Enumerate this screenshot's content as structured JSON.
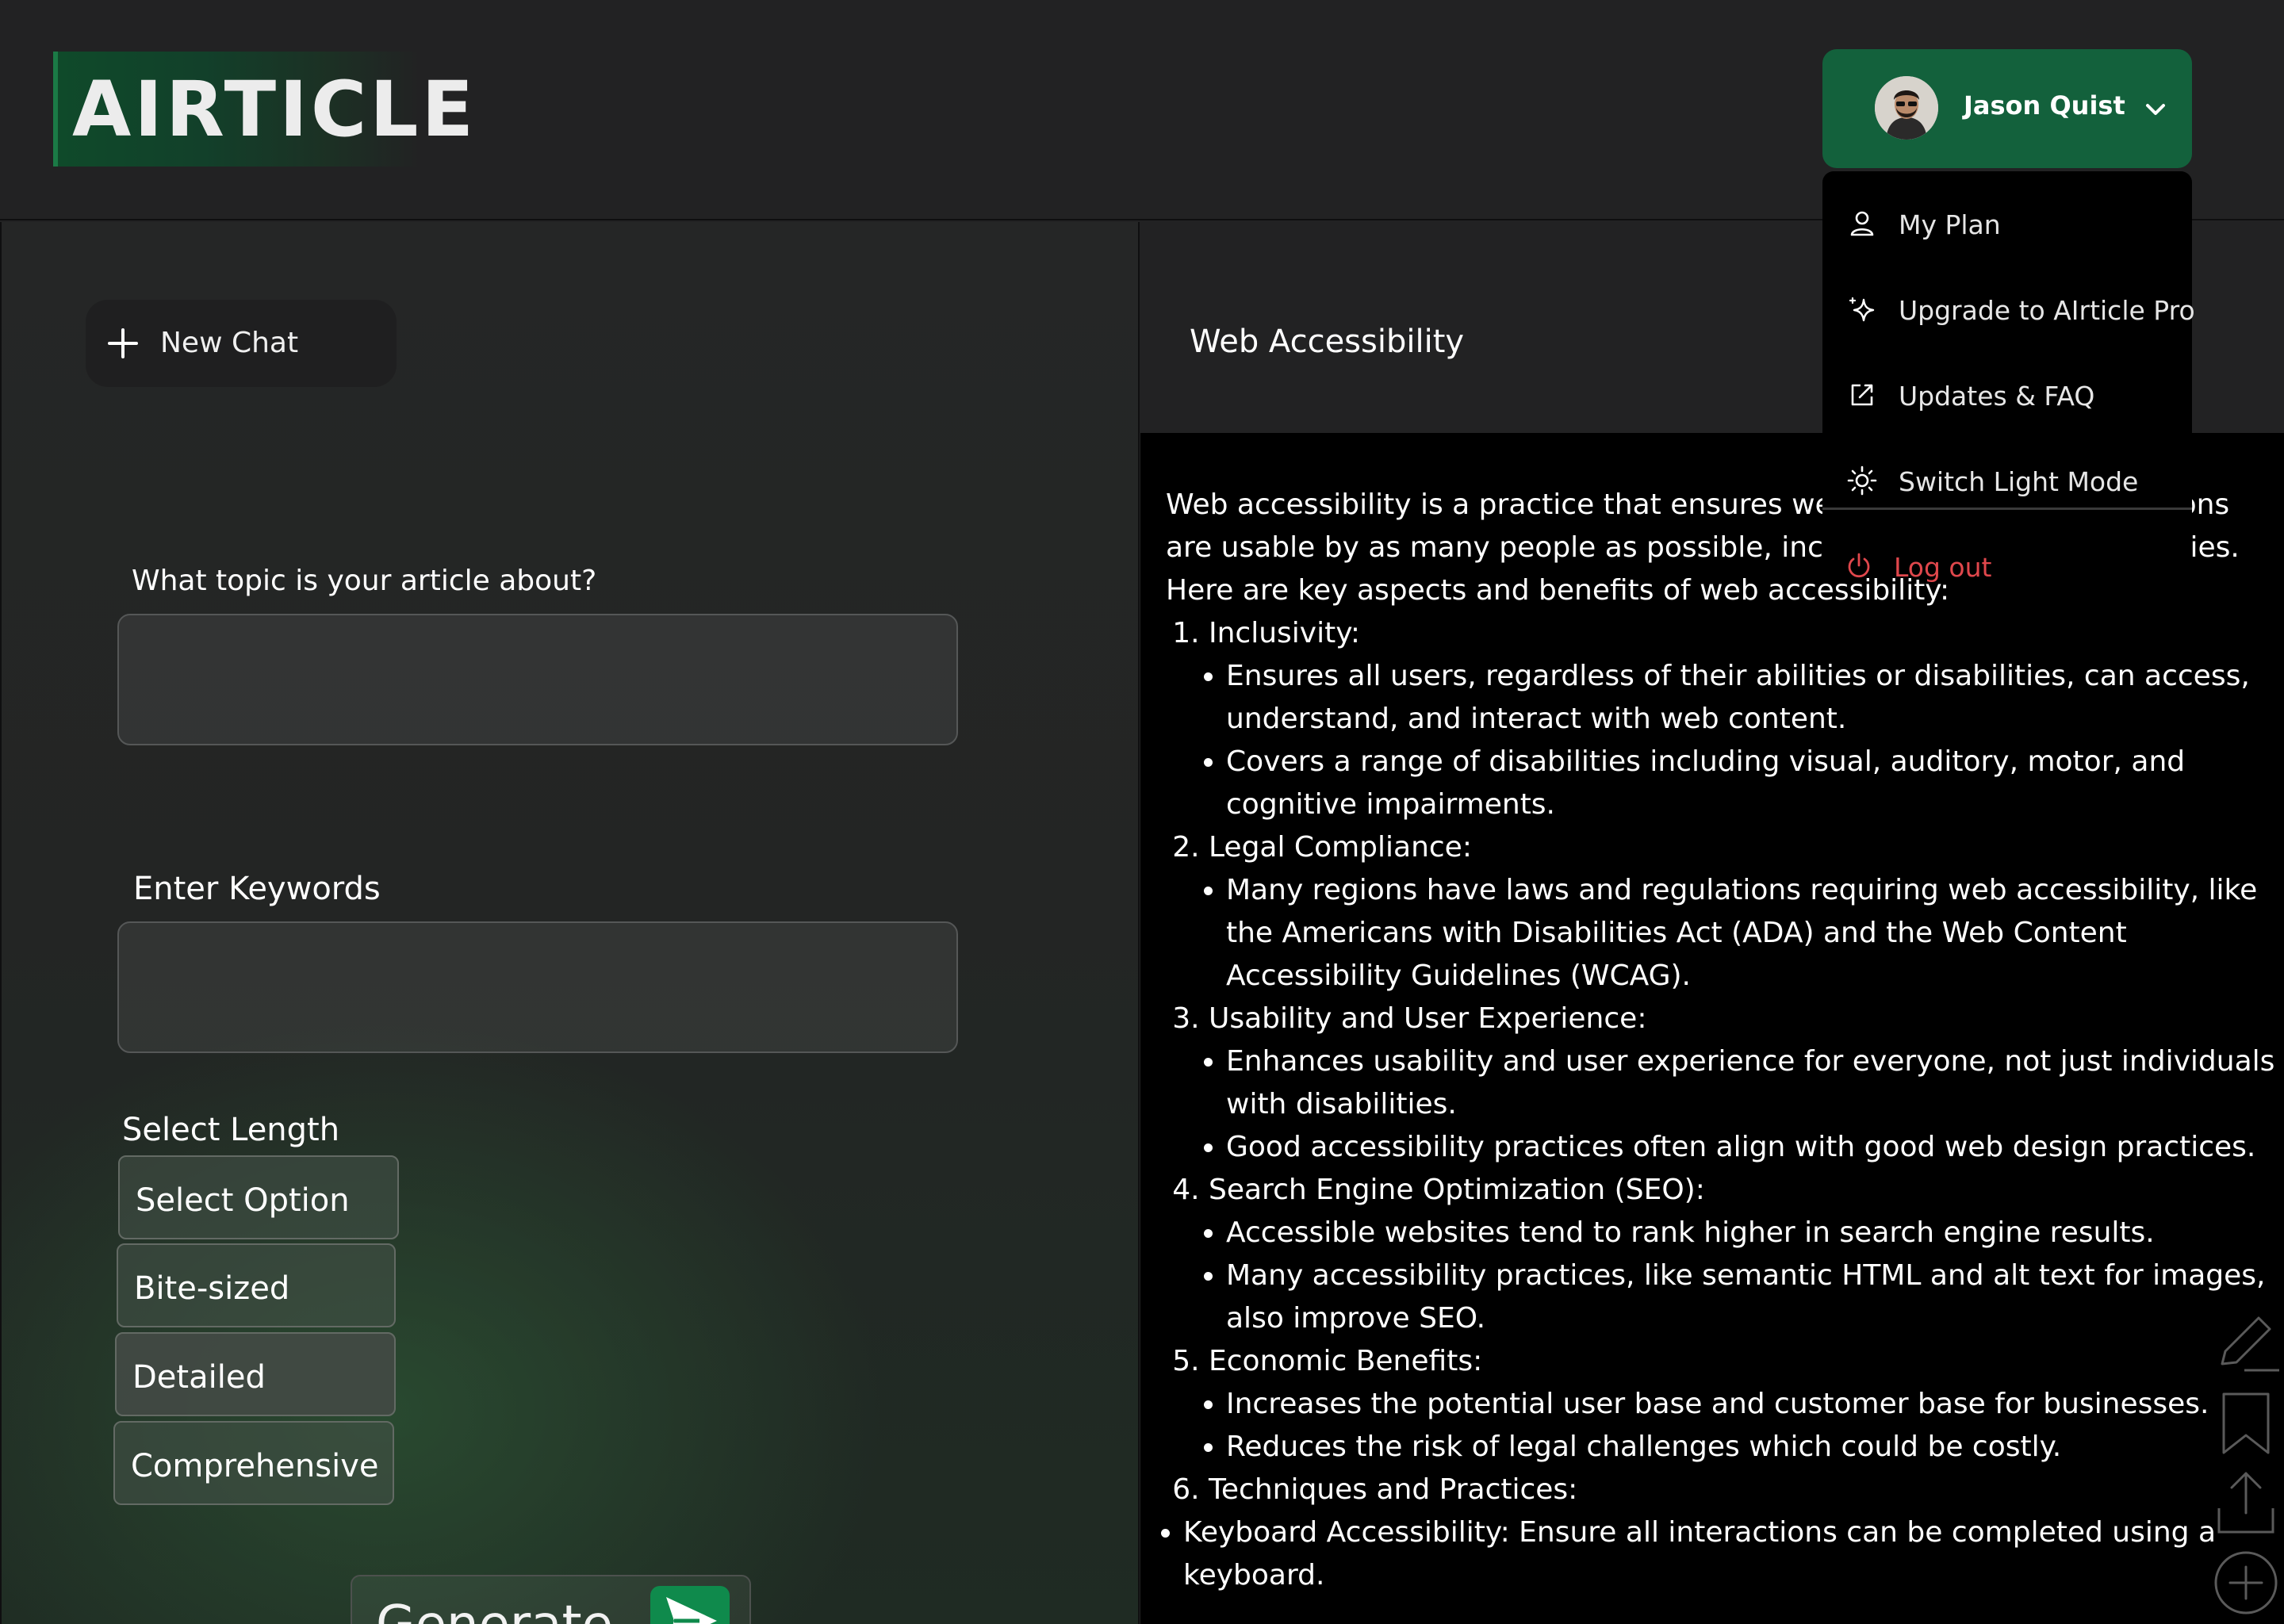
{
  "app": {
    "logo": "AIRTICLE",
    "accent_color": "#13613c"
  },
  "user": {
    "name": "Jason Quist",
    "menu": {
      "items": [
        {
          "icon": "user-icon",
          "label": "My Plan"
        },
        {
          "icon": "sparkle-icon",
          "label": "Upgrade to AIrticle Pro"
        },
        {
          "icon": "external-link-icon",
          "label": "Updates & FAQ"
        },
        {
          "icon": "sun-icon",
          "label": "Switch Light Mode"
        }
      ],
      "logout": {
        "icon": "power-icon",
        "label": "Log out",
        "color": "#e0474c"
      }
    }
  },
  "sidebar": {
    "new_chat": "New Chat"
  },
  "form": {
    "topic_label": "What topic is your article about?",
    "topic_value": "",
    "keywords_label": "Enter Keywords",
    "keywords_value": "",
    "length_label": "Select Length",
    "length_options": [
      "Select Option",
      "Bite-sized",
      "Detailed",
      "Comprehensive"
    ],
    "generate_label": "Generate"
  },
  "article": {
    "title": "Web Accessibility",
    "intro": "Web accessibility is a practice that ensures websites and web applications are usable by as many people as possible, including those with disabilities. Here are key aspects and benefits of web accessibility:",
    "sections": [
      {
        "heading": "Inclusivity:",
        "points": [
          "Ensures all users, regardless of their abilities or disabilities, can access, understand, and interact with web content.",
          "Covers a range of disabilities including visual, auditory, motor, and cognitive impairments."
        ]
      },
      {
        "heading": "Legal Compliance:",
        "points": [
          "Many regions have laws and regulations requiring web accessibility, like the Americans with Disabilities Act (ADA) and the Web Content Accessibility Guidelines (WCAG)."
        ]
      },
      {
        "heading": "Usability and User Experience:",
        "points": [
          "Enhances usability and user experience for everyone, not just individuals with disabilities.",
          "Good accessibility practices often align with good web design practices."
        ]
      },
      {
        "heading": "Search Engine Optimization (SEO):",
        "points": [
          "Accessible websites tend to rank higher in search engine results.",
          "Many accessibility practices, like semantic HTML and alt text for images, also improve SEO."
        ]
      },
      {
        "heading": "Economic Benefits:",
        "points": [
          "Increases the potential user base and customer base for businesses.",
          "Reduces the risk of legal challenges which could be costly."
        ]
      },
      {
        "heading": "Techniques and Practices:",
        "points": []
      }
    ],
    "trailing_points": [
      "Keyboard Accessibility: Ensure all interactions can be completed using a keyboard."
    ]
  },
  "tools": [
    "edit-icon",
    "bookmark-icon",
    "share-icon",
    "add-icon"
  ]
}
